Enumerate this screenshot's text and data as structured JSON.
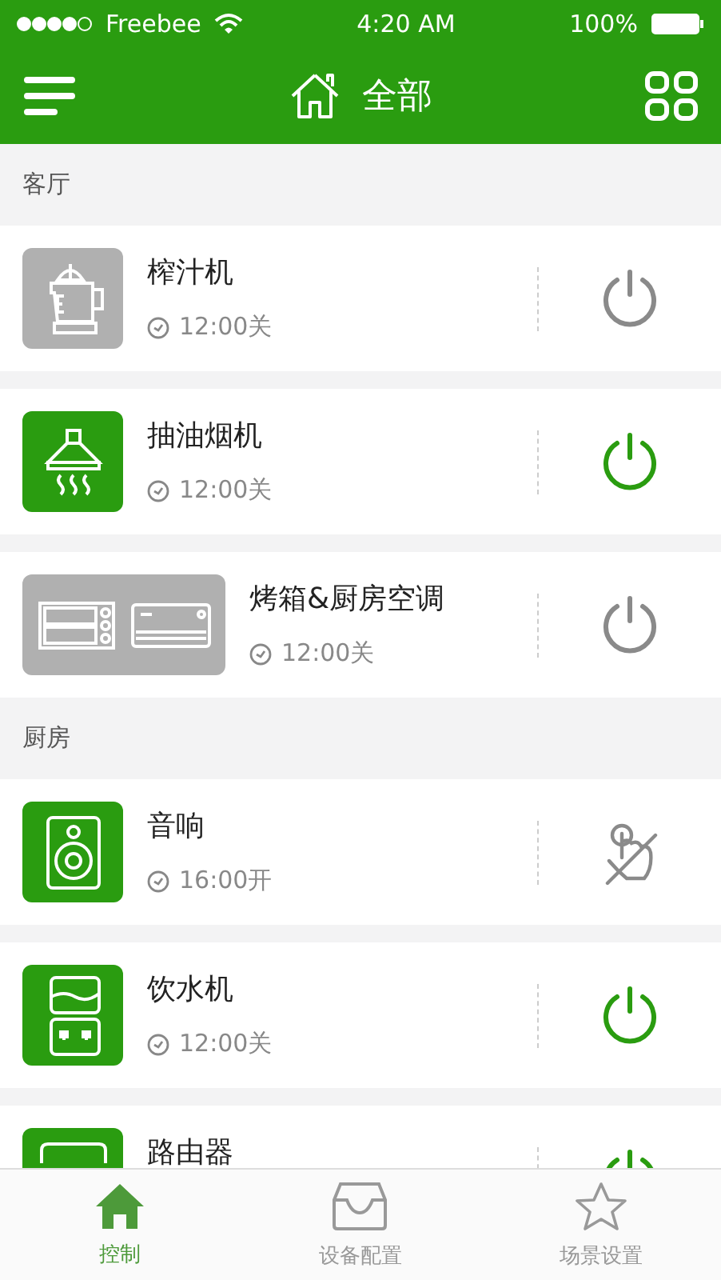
{
  "status_bar": {
    "carrier": "Freebee",
    "time": "4:20 AM",
    "battery": "100%"
  },
  "header": {
    "title": "全部"
  },
  "sections": [
    {
      "title": "客厅",
      "devices": [
        {
          "kind": "juicer",
          "name": "榨汁机",
          "timer": "12:00关",
          "on": false,
          "control": {
            "kind": "power"
          }
        },
        {
          "kind": "hood",
          "name": "抽油烟机",
          "timer": "12:00关",
          "on": true,
          "control": {
            "kind": "power"
          }
        },
        {
          "kind": "oven_ac",
          "name": "烤箱&厨房空调",
          "timer": "12:00关",
          "on": false,
          "control": {
            "kind": "power"
          }
        }
      ]
    },
    {
      "title": "厨房",
      "devices": [
        {
          "kind": "speaker",
          "name": "音响",
          "timer": "16:00开",
          "on": true,
          "control": {
            "kind": "touch_disabled"
          }
        },
        {
          "kind": "water",
          "name": "饮水机",
          "timer": "12:00关",
          "on": true,
          "control": {
            "kind": "power"
          }
        },
        {
          "kind": "router",
          "name": "路由器",
          "on": true,
          "control": {
            "kind": "power"
          }
        }
      ]
    }
  ],
  "tabs": [
    {
      "kind": "home",
      "label": "控制",
      "selected": true
    },
    {
      "kind": "box",
      "label": "设备配置",
      "selected": false
    },
    {
      "kind": "star",
      "label": "场景设置",
      "selected": false
    }
  ]
}
